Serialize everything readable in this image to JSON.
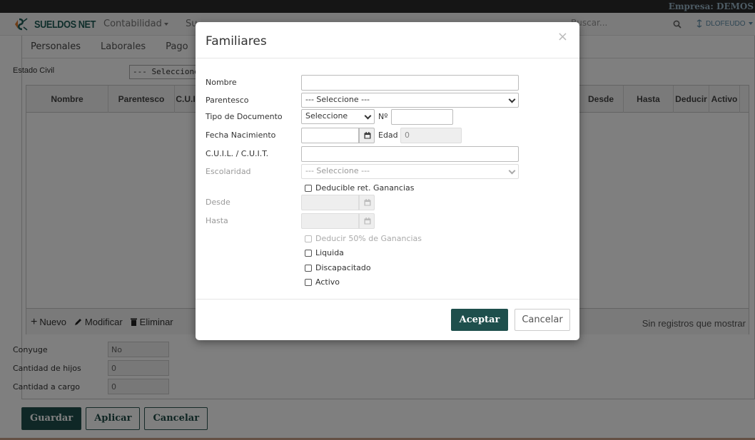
{
  "topbar": {
    "empresa": "Empresa: DEMOS"
  },
  "navbar": {
    "brand": "SUELDOS NET",
    "menu_contabilidad": "Contabilidad",
    "menu_partial": "Su",
    "search_placeholder": "Buscar...",
    "user": "DLOFEUDO"
  },
  "tabs": [
    "Personales",
    "Laborales",
    "Pago"
  ],
  "estado_civil": {
    "label": "Estado Civil",
    "value": "--- Seleccione ---"
  },
  "grid": {
    "columns": [
      "Nombre",
      "Parentesco",
      "C.U.I",
      "Desde",
      "Hasta",
      "Deducir",
      "Activo"
    ],
    "actions": {
      "nuevo": "Nuevo",
      "modificar": "Modificar",
      "eliminar": "Eliminar"
    },
    "empty_message": "Sin registros que mostrar"
  },
  "lower_fields": [
    {
      "label": "Conyuge",
      "value": "No"
    },
    {
      "label": "Cantidad de hijos",
      "value": "0"
    },
    {
      "label": "Cantidad a cargo",
      "value": "0"
    }
  ],
  "bottom_buttons": {
    "guardar": "Guardar",
    "aplicar": "Aplicar",
    "cancelar": "Cancelar"
  },
  "modal": {
    "title": "Familiares",
    "close": "×",
    "labels": {
      "nombre": "Nombre",
      "parentesco": "Parentesco",
      "tipo_documento": "Tipo de Documento",
      "numero": "Nº",
      "fecha_nacimiento": "Fecha Nacimiento",
      "edad": "Edad",
      "cuil": "C.U.I.L. / C.U.I.T.",
      "escolaridad": "Escolaridad",
      "desde": "Desde",
      "hasta": "Hasta"
    },
    "values": {
      "nombre": "",
      "parentesco": "--- Seleccione ---",
      "tipo_documento": "Seleccione",
      "numero": "",
      "fecha_nacimiento": "",
      "edad": "0",
      "cuil": "",
      "escolaridad": "--- Seleccione ---",
      "desde": "",
      "hasta": ""
    },
    "checkboxes": {
      "deducible": "Deducible ret. Ganancias",
      "deducir50": "Deducir 50% de Ganancias",
      "liquida": "Liquida",
      "discapacitado": "Discapacitado",
      "activo": "Activo"
    },
    "buttons": {
      "aceptar": "Aceptar",
      "cancelar": "Cancelar"
    }
  },
  "colors": {
    "brand": "#1e5d57",
    "primary_button": "#1e4f4c",
    "empresa_text": "#9ab7c9"
  }
}
